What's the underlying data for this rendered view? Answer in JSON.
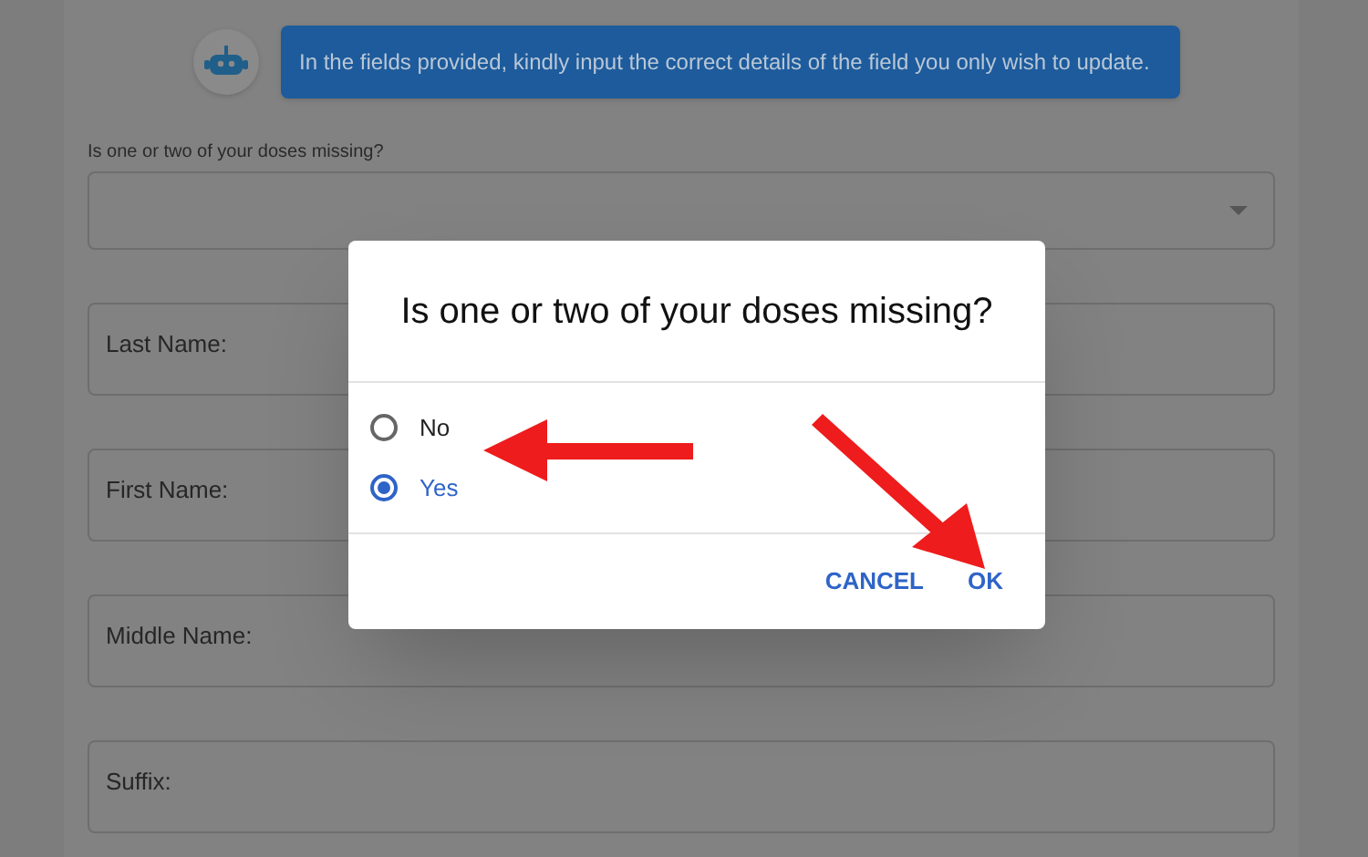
{
  "banner": {
    "message": "In the fields provided, kindly input the correct details of the field you only wish to update."
  },
  "select": {
    "label": "Is one or two of your doses missing?"
  },
  "fields": [
    {
      "label": "Last Name:"
    },
    {
      "label": "First Name:"
    },
    {
      "label": "Middle Name:"
    },
    {
      "label": "Suffix:"
    }
  ],
  "dialog": {
    "title": "Is one or two of your doses missing?",
    "options": [
      {
        "label": "No",
        "selected": false
      },
      {
        "label": "Yes",
        "selected": true
      }
    ],
    "buttons": [
      {
        "label": "CANCEL"
      },
      {
        "label": "OK"
      }
    ]
  }
}
